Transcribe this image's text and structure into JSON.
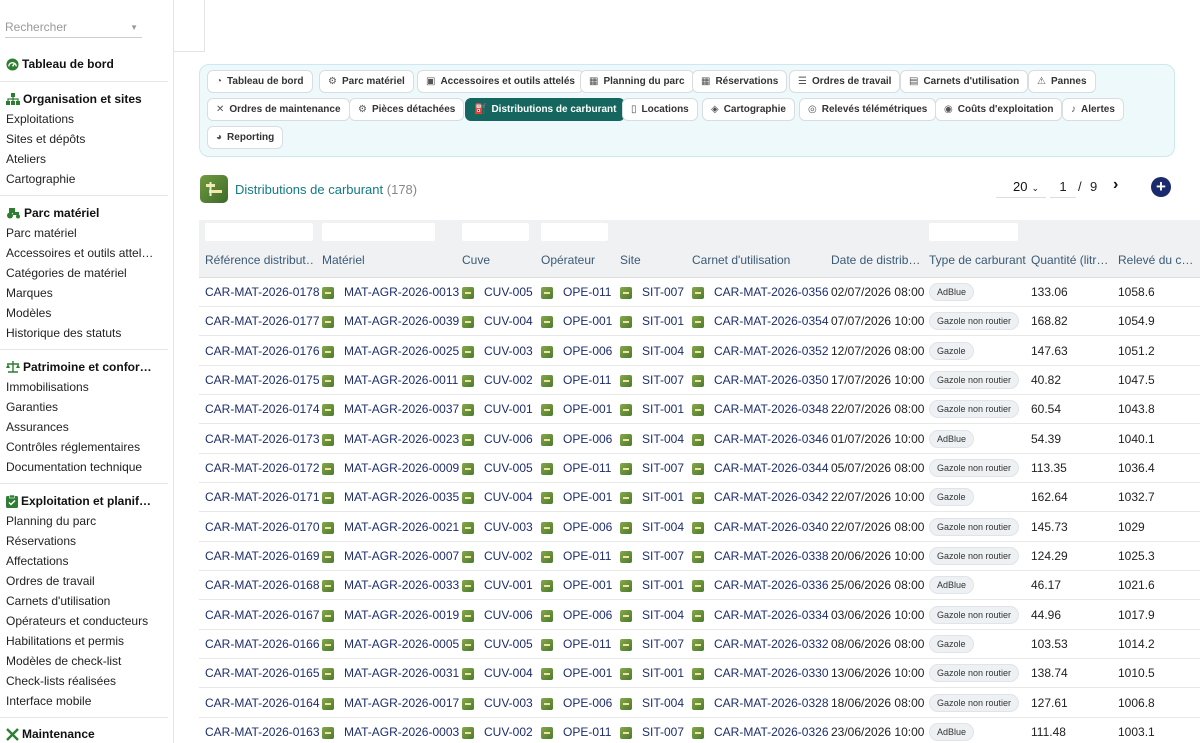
{
  "sidebar": {
    "search_placeholder": "Rechercher",
    "sections": [
      {
        "title": "Tableau de bord",
        "icon": "gauge-icon",
        "items": []
      },
      {
        "title": "Organisation et sites",
        "icon": "org-chart-icon",
        "items": [
          "Exploitations",
          "Sites et dépôts",
          "Ateliers",
          "Cartographie"
        ]
      },
      {
        "title": "Parc matériel",
        "icon": "tractor-icon",
        "items": [
          "Parc matériel",
          "Accessoires et outils attel…",
          "Catégories de matériel",
          "Marques",
          "Modèles",
          "Historique des statuts"
        ]
      },
      {
        "title": "Patrimoine et confor…",
        "icon": "scale-icon",
        "items": [
          "Immobilisations",
          "Garanties",
          "Assurances",
          "Contrôles réglementaires",
          "Documentation technique"
        ]
      },
      {
        "title": "Exploitation et planif…",
        "icon": "clipboard-check-icon",
        "items": [
          "Planning du parc",
          "Réservations",
          "Affectations",
          "Ordres de travail",
          "Carnets d'utilisation",
          "Opérateurs et conducteurs",
          "Habilitations et permis",
          "Modèles de check-list",
          "Check-lists réalisées",
          "Interface mobile"
        ]
      },
      {
        "title": "Maintenance",
        "icon": "tools-icon",
        "items": []
      }
    ]
  },
  "tabs": [
    {
      "label": "Tableau de bord",
      "icon": "gauge-icon",
      "active": false
    },
    {
      "label": "Parc matériel",
      "icon": "tractor-icon",
      "active": false
    },
    {
      "label": "Accessoires et outils attelés",
      "icon": "trailer-icon",
      "active": false
    },
    {
      "label": "Planning du parc",
      "icon": "calendar-icon",
      "active": false
    },
    {
      "label": "Réservations",
      "icon": "calendar-check-icon",
      "active": false
    },
    {
      "label": "Ordres de travail",
      "icon": "list-icon",
      "active": false
    },
    {
      "label": "Carnets d'utilisation",
      "icon": "book-icon",
      "active": false
    },
    {
      "label": "Pannes",
      "icon": "warning-icon",
      "active": false
    },
    {
      "label": "Ordres de maintenance",
      "icon": "tools-icon",
      "active": false
    },
    {
      "label": "Pièces détachées",
      "icon": "gear-icon",
      "active": false
    },
    {
      "label": "Distributions de carburant",
      "icon": "fuel-icon",
      "active": true
    },
    {
      "label": "Locations",
      "icon": "document-icon",
      "active": false
    },
    {
      "label": "Cartographie",
      "icon": "map-icon",
      "active": false
    },
    {
      "label": "Relevés télémétriques",
      "icon": "satellite-icon",
      "active": false
    },
    {
      "label": "Coûts d'exploitation",
      "icon": "coins-icon",
      "active": false
    },
    {
      "label": "Alertes",
      "icon": "bell-icon",
      "active": false
    },
    {
      "label": "Reporting",
      "icon": "pie-chart-icon",
      "active": false
    }
  ],
  "header": {
    "title": "Distributions de carburant",
    "count": "(178)"
  },
  "pagination": {
    "per_page": "20",
    "current": "1",
    "separator": "/",
    "total": "9",
    "next": "›",
    "add": "+"
  },
  "columns": [
    "Référence distribut…",
    "Matériel",
    "Cuve",
    "Opérateur",
    "Site",
    "Carnet d'utilisation",
    "Date de distrib…",
    "Type de carburant",
    "Quantité (litr…",
    "Relevé du c…"
  ],
  "rows": [
    {
      "ref": "CAR-MAT-2026-0178",
      "materiel": "MAT-AGR-2026-0013",
      "cuve": "CUV-005",
      "operateur": "OPE-011",
      "site": "SIT-007",
      "carnet": "CAR-MAT-2026-0356",
      "date": "02/07/2026 08:00",
      "type": "AdBlue",
      "quantite": "133.06",
      "releve": "1058.6"
    },
    {
      "ref": "CAR-MAT-2026-0177",
      "materiel": "MAT-AGR-2026-0039",
      "cuve": "CUV-004",
      "operateur": "OPE-001",
      "site": "SIT-001",
      "carnet": "CAR-MAT-2026-0354",
      "date": "07/07/2026 10:00",
      "type": "Gazole non routier",
      "quantite": "168.82",
      "releve": "1054.9"
    },
    {
      "ref": "CAR-MAT-2026-0176",
      "materiel": "MAT-AGR-2026-0025",
      "cuve": "CUV-003",
      "operateur": "OPE-006",
      "site": "SIT-004",
      "carnet": "CAR-MAT-2026-0352",
      "date": "12/07/2026 08:00",
      "type": "Gazole",
      "quantite": "147.63",
      "releve": "1051.2"
    },
    {
      "ref": "CAR-MAT-2026-0175",
      "materiel": "MAT-AGR-2026-0011",
      "cuve": "CUV-002",
      "operateur": "OPE-011",
      "site": "SIT-007",
      "carnet": "CAR-MAT-2026-0350",
      "date": "17/07/2026 10:00",
      "type": "Gazole non routier",
      "quantite": "40.82",
      "releve": "1047.5"
    },
    {
      "ref": "CAR-MAT-2026-0174",
      "materiel": "MAT-AGR-2026-0037",
      "cuve": "CUV-001",
      "operateur": "OPE-001",
      "site": "SIT-001",
      "carnet": "CAR-MAT-2026-0348",
      "date": "22/07/2026 08:00",
      "type": "Gazole non routier",
      "quantite": "60.54",
      "releve": "1043.8"
    },
    {
      "ref": "CAR-MAT-2026-0173",
      "materiel": "MAT-AGR-2026-0023",
      "cuve": "CUV-006",
      "operateur": "OPE-006",
      "site": "SIT-004",
      "carnet": "CAR-MAT-2026-0346",
      "date": "01/07/2026 10:00",
      "type": "AdBlue",
      "quantite": "54.39",
      "releve": "1040.1"
    },
    {
      "ref": "CAR-MAT-2026-0172",
      "materiel": "MAT-AGR-2026-0009",
      "cuve": "CUV-005",
      "operateur": "OPE-011",
      "site": "SIT-007",
      "carnet": "CAR-MAT-2026-0344",
      "date": "05/07/2026 08:00",
      "type": "Gazole non routier",
      "quantite": "113.35",
      "releve": "1036.4"
    },
    {
      "ref": "CAR-MAT-2026-0171",
      "materiel": "MAT-AGR-2026-0035",
      "cuve": "CUV-004",
      "operateur": "OPE-001",
      "site": "SIT-001",
      "carnet": "CAR-MAT-2026-0342",
      "date": "22/07/2026 10:00",
      "type": "Gazole",
      "quantite": "162.64",
      "releve": "1032.7"
    },
    {
      "ref": "CAR-MAT-2026-0170",
      "materiel": "MAT-AGR-2026-0021",
      "cuve": "CUV-003",
      "operateur": "OPE-006",
      "site": "SIT-004",
      "carnet": "CAR-MAT-2026-0340",
      "date": "22/07/2026 08:00",
      "type": "Gazole non routier",
      "quantite": "145.73",
      "releve": "1029"
    },
    {
      "ref": "CAR-MAT-2026-0169",
      "materiel": "MAT-AGR-2026-0007",
      "cuve": "CUV-002",
      "operateur": "OPE-011",
      "site": "SIT-007",
      "carnet": "CAR-MAT-2026-0338",
      "date": "20/06/2026 10:00",
      "type": "Gazole non routier",
      "quantite": "124.29",
      "releve": "1025.3"
    },
    {
      "ref": "CAR-MAT-2026-0168",
      "materiel": "MAT-AGR-2026-0033",
      "cuve": "CUV-001",
      "operateur": "OPE-001",
      "site": "SIT-001",
      "carnet": "CAR-MAT-2026-0336",
      "date": "25/06/2026 08:00",
      "type": "AdBlue",
      "quantite": "46.17",
      "releve": "1021.6"
    },
    {
      "ref": "CAR-MAT-2026-0167",
      "materiel": "MAT-AGR-2026-0019",
      "cuve": "CUV-006",
      "operateur": "OPE-006",
      "site": "SIT-004",
      "carnet": "CAR-MAT-2026-0334",
      "date": "03/06/2026 10:00",
      "type": "Gazole non routier",
      "quantite": "44.96",
      "releve": "1017.9"
    },
    {
      "ref": "CAR-MAT-2026-0166",
      "materiel": "MAT-AGR-2026-0005",
      "cuve": "CUV-005",
      "operateur": "OPE-011",
      "site": "SIT-007",
      "carnet": "CAR-MAT-2026-0332",
      "date": "08/06/2026 08:00",
      "type": "Gazole",
      "quantite": "103.53",
      "releve": "1014.2"
    },
    {
      "ref": "CAR-MAT-2026-0165",
      "materiel": "MAT-AGR-2026-0031",
      "cuve": "CUV-004",
      "operateur": "OPE-001",
      "site": "SIT-001",
      "carnet": "CAR-MAT-2026-0330",
      "date": "13/06/2026 10:00",
      "type": "Gazole non routier",
      "quantite": "138.74",
      "releve": "1010.5"
    },
    {
      "ref": "CAR-MAT-2026-0164",
      "materiel": "MAT-AGR-2026-0017",
      "cuve": "CUV-003",
      "operateur": "OPE-006",
      "site": "SIT-004",
      "carnet": "CAR-MAT-2026-0328",
      "date": "18/06/2026 08:00",
      "type": "Gazole non routier",
      "quantite": "127.61",
      "releve": "1006.8"
    },
    {
      "ref": "CAR-MAT-2026-0163",
      "materiel": "MAT-AGR-2026-0003",
      "cuve": "CUV-002",
      "operateur": "OPE-011",
      "site": "SIT-007",
      "carnet": "CAR-MAT-2026-0326",
      "date": "23/06/2026 10:00",
      "type": "AdBlue",
      "quantite": "111.48",
      "releve": "1003.1"
    }
  ],
  "colors": {
    "accent": "#14665f",
    "link": "#1d2d6e",
    "title": "#137a84",
    "panel": "#eef9fb"
  }
}
